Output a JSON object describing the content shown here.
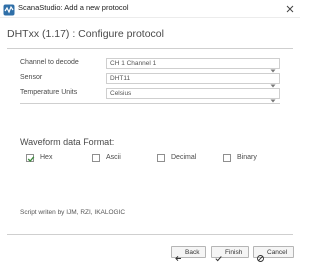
{
  "window": {
    "title": "ScanaStudio: Add a new protocol",
    "icons": {
      "app": "scanastudio-app-icon",
      "close": "close-icon"
    }
  },
  "page": {
    "heading": "DHTxx (1.17) : Configure protocol"
  },
  "form": {
    "channel": {
      "label": "Channel to decode",
      "value": "CH 1 Channel 1"
    },
    "sensor": {
      "label": "Sensor",
      "value": "DHT11"
    },
    "temperature": {
      "label": "Temperature Units",
      "value": "Celsius"
    }
  },
  "waveform": {
    "title": "Waveform data Format:",
    "options": [
      {
        "label": "Hex",
        "checked": true
      },
      {
        "label": "Ascii",
        "checked": false
      },
      {
        "label": "Decimal",
        "checked": false
      },
      {
        "label": "Binary",
        "checked": false
      }
    ]
  },
  "footer": {
    "script_credit": "Script writen by IJM, RZI, IKALOGIC"
  },
  "buttons": {
    "back": {
      "label": "Back",
      "icon": "arrow-left-icon"
    },
    "finish": {
      "label": "Finish",
      "icon": "check-icon"
    },
    "cancel": {
      "label": "Cancel",
      "icon": "cancel-icon"
    }
  },
  "colors": {
    "accent_green": "#3c8c3c",
    "border": "#cfcfcf"
  }
}
